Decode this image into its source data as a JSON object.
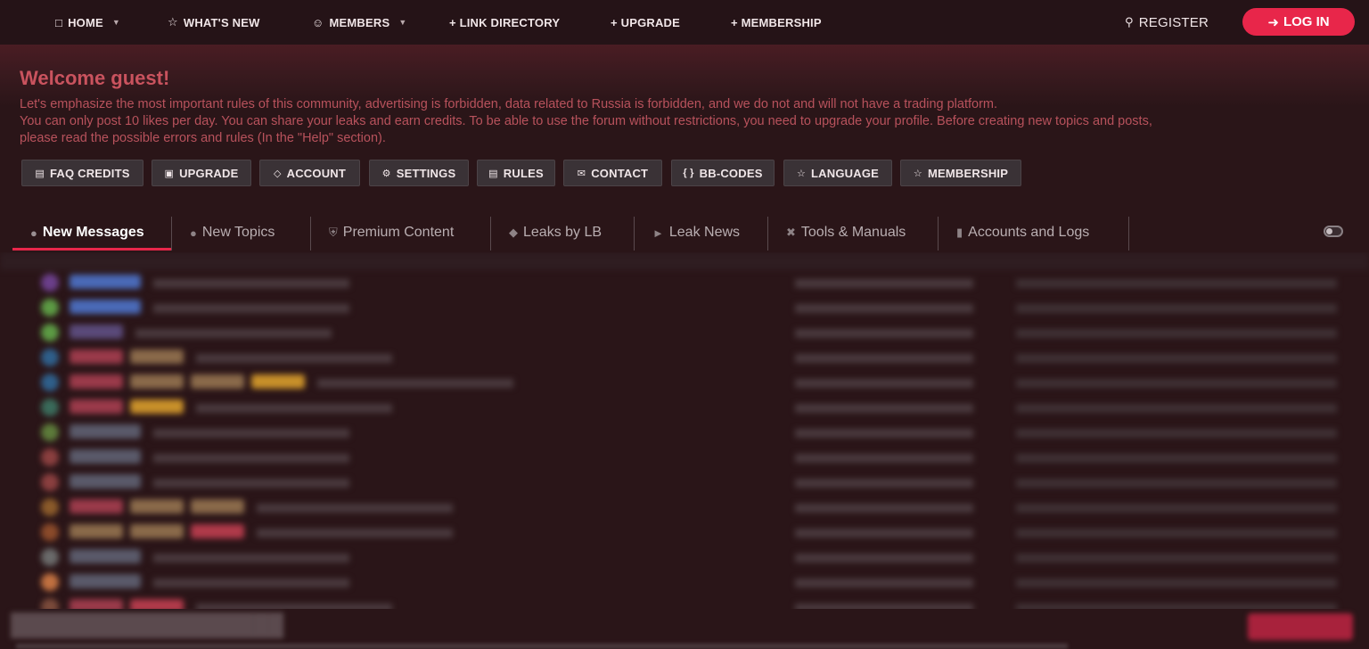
{
  "nav": {
    "home": "HOME",
    "whats_new": "WHAT'S NEW",
    "members": "MEMBERS",
    "link_directory": "+ LINK DIRECTORY",
    "upgrade": "+ UPGRADE",
    "membership": "+ MEMBERSHIP",
    "register": "REGISTER",
    "login": "LOG IN"
  },
  "welcome": {
    "title": "Welcome guest!",
    "line1": "Let's emphasize the most important rules of this community, advertising is forbidden, data related to Russia is forbidden, and we do not and will not have a trading platform.",
    "line2": "You can only post 10 likes per day. You can share your leaks and earn credits. To be able to use the forum without restrictions, you need to upgrade your profile. Before creating new topics and posts,",
    "line3": "please read the possible errors and rules (In the \"Help\" section)."
  },
  "quick_buttons": [
    {
      "label": "FAQ CREDITS",
      "icon": "database-icon"
    },
    {
      "label": "UPGRADE",
      "icon": "gift-icon"
    },
    {
      "label": "ACCOUNT",
      "icon": "tag-icon"
    },
    {
      "label": "SETTINGS",
      "icon": "settings-icon"
    },
    {
      "label": "RULES",
      "icon": "clipboard-icon"
    },
    {
      "label": "CONTACT",
      "icon": "envelope-icon"
    },
    {
      "label": "BB-CODES",
      "icon": "braces-icon"
    },
    {
      "label": "LANGUAGE",
      "icon": "star-icon"
    },
    {
      "label": "MEMBERSHIP",
      "icon": "star-icon"
    }
  ],
  "tabs": [
    {
      "label": "New Messages",
      "icon": "chat-icon",
      "active": true
    },
    {
      "label": "New Topics",
      "icon": "chat-icon"
    },
    {
      "label": "Premium Content",
      "icon": "shield-icon"
    },
    {
      "label": "Leaks by LB",
      "icon": "diamond-icon"
    },
    {
      "label": "Leak News",
      "icon": "megaphone-icon"
    },
    {
      "label": "Tools & Manuals",
      "icon": "tools-icon"
    },
    {
      "label": "Accounts and Logs",
      "icon": "chart-icon"
    }
  ],
  "colors": {
    "accent": "#e8264a",
    "welcome_text": "#c9535e",
    "background": "#2a1518"
  }
}
